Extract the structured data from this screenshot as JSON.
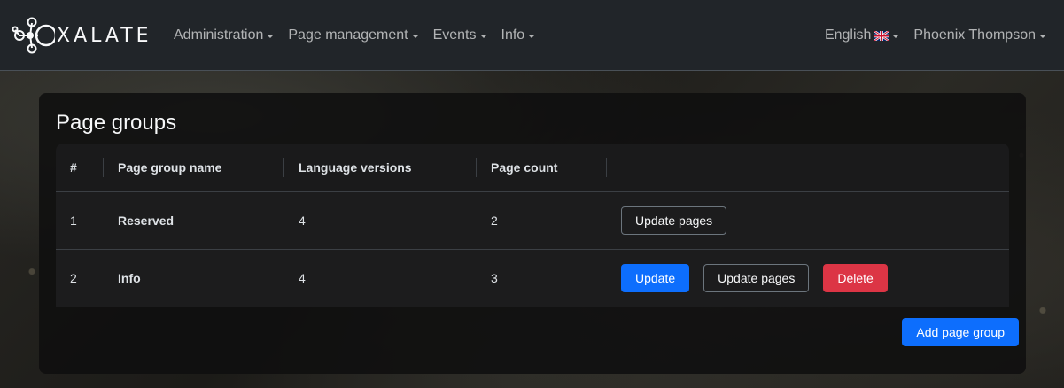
{
  "brand": {
    "name": "XALATE"
  },
  "nav": {
    "left": [
      {
        "label": "Administration"
      },
      {
        "label": "Page management"
      },
      {
        "label": "Events"
      },
      {
        "label": "Info"
      }
    ],
    "language": {
      "label": "English",
      "flag_icon": "uk-flag-icon"
    },
    "user": {
      "label": "Phoenix Thompson"
    }
  },
  "main": {
    "title": "Page groups",
    "table": {
      "headers": [
        "#",
        "Page group name",
        "Language versions",
        "Page count",
        ""
      ],
      "rows": [
        {
          "index": "1",
          "name": "Reserved",
          "language_versions": "4",
          "page_count": "2",
          "actions": {
            "update_pages": "Update pages"
          }
        },
        {
          "index": "2",
          "name": "Info",
          "language_versions": "4",
          "page_count": "3",
          "actions": {
            "update": "Update",
            "update_pages": "Update pages",
            "delete": "Delete"
          }
        }
      ]
    },
    "add_button": "Add page group"
  },
  "colors": {
    "navbar_bg": "#212529",
    "primary": "#0d6efd",
    "danger": "#dc3545",
    "card_bg": "#0f0f0f"
  }
}
